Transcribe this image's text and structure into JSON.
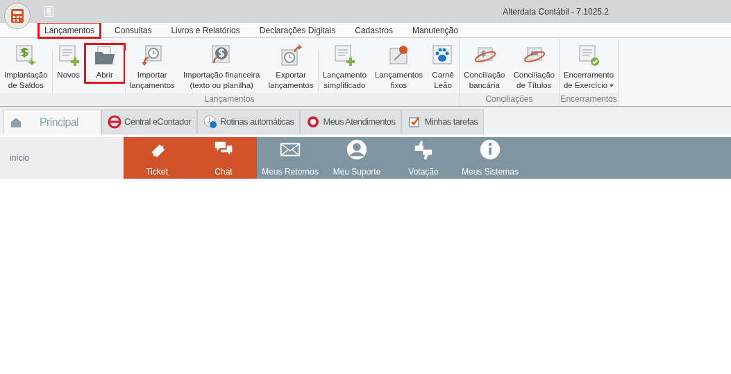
{
  "window": {
    "title": "Alterdata Contábil - 7.1025.2"
  },
  "menu_tabs": [
    {
      "label": "Lançamentos",
      "selected": true,
      "highlighted": true
    },
    {
      "label": "Consultas",
      "selected": false,
      "highlighted": false
    },
    {
      "label": "Livros e Relatórios",
      "selected": false,
      "highlighted": false
    },
    {
      "label": "Declarações Digitais",
      "selected": false,
      "highlighted": false
    },
    {
      "label": "Cadastros",
      "selected": false,
      "highlighted": false
    },
    {
      "label": "Manutenção",
      "selected": false,
      "highlighted": false
    }
  ],
  "ribbon_groups": [
    {
      "label": "Lançamentos",
      "items": [
        {
          "lines": [
            "Implantação",
            "de Saldos"
          ],
          "highlighted": false
        },
        {
          "lines": [
            "Novos"
          ],
          "highlighted": false
        },
        {
          "lines": [
            "Abrir"
          ],
          "highlighted": true
        },
        {
          "lines": [
            "Importar",
            "lançamentos"
          ],
          "highlighted": false
        },
        {
          "lines": [
            "Importação financeira",
            "(texto ou planilha)"
          ],
          "highlighted": false
        },
        {
          "lines": [
            "Exportar",
            "lançamentos"
          ],
          "highlighted": false
        },
        {
          "lines": [
            "Lançamento",
            "simplificado"
          ],
          "highlighted": false
        },
        {
          "lines": [
            "Lançamentos",
            "fixos"
          ],
          "highlighted": false
        },
        {
          "lines": [
            "Carnê",
            "Leão"
          ],
          "highlighted": false
        }
      ]
    },
    {
      "label": "Conciliações",
      "items": [
        {
          "lines": [
            "Conciliação",
            "bancária"
          ],
          "highlighted": false
        },
        {
          "lines": [
            "Conciliação",
            "de Títulos"
          ],
          "highlighted": false
        }
      ]
    },
    {
      "label": "Encerramentos",
      "items": [
        {
          "lines": [
            "Encerramento",
            "de Exercício"
          ],
          "dropdown": true,
          "highlighted": false
        }
      ]
    }
  ],
  "doc_tabs": [
    {
      "label": "Principal",
      "selected": true
    },
    {
      "label": "Central eContador",
      "selected": false
    },
    {
      "label": "Rotinas automáticas",
      "selected": false
    },
    {
      "label": "Meus Atendimentos",
      "selected": false
    },
    {
      "label": "Minhas tarefas",
      "selected": false
    }
  ],
  "breadcrumb": "início",
  "tiles": [
    {
      "label": "Ticket",
      "color": "#d0532a"
    },
    {
      "label": "Chat",
      "color": "#d0532a"
    },
    {
      "label": "Meus Retornos",
      "color": "#7f95a1"
    },
    {
      "label": "Meu Suporte",
      "color": "#7f95a1"
    },
    {
      "label": "Votação",
      "color": "#7f95a1"
    },
    {
      "label": "Meus Sistemas",
      "color": "#7f95a1"
    }
  ]
}
